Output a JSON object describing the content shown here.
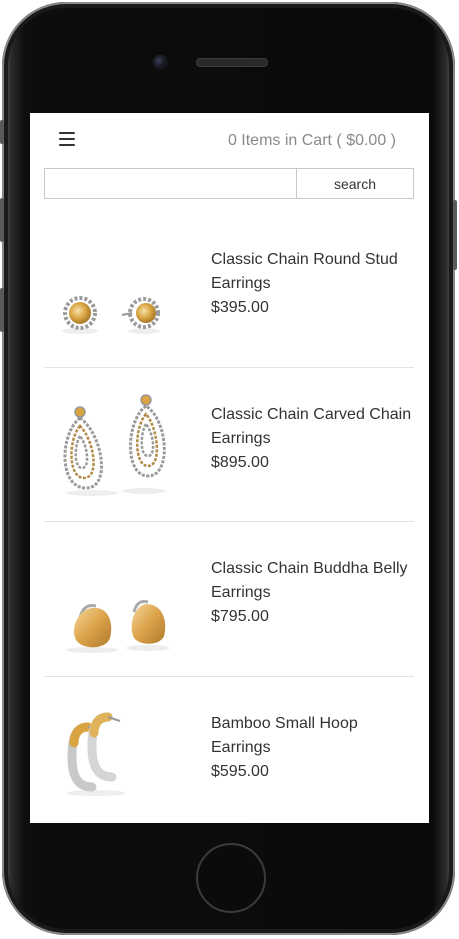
{
  "header": {
    "menu_icon": "hamburger-menu-icon",
    "cart_text": "0 Items in Cart ( $0.00 )"
  },
  "search": {
    "value": "",
    "placeholder": "",
    "button_label": "search"
  },
  "products": [
    {
      "name": "Classic Chain Round Stud Earrings",
      "price": "$395.00"
    },
    {
      "name": "Classic Chain Carved Chain Earrings",
      "price": "$895.00"
    },
    {
      "name": "Classic Chain Buddha Belly Earrings",
      "price": "$795.00"
    },
    {
      "name": "Bamboo Small Hoop Earrings",
      "price": "$595.00"
    }
  ],
  "colors": {
    "gold": "#d9a441",
    "silver": "#b8b8b8",
    "text": "#333333",
    "muted": "#8a8a8a"
  }
}
